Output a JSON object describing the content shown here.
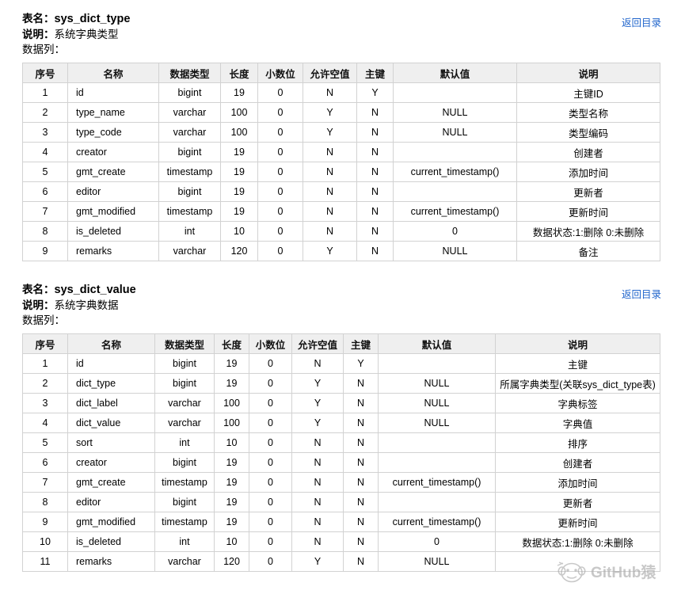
{
  "document": {
    "watermark_text": "GitHub猿",
    "link_color": "#2266cc",
    "header_bg": "#efefef",
    "border_color": "#d2d2d2"
  },
  "labels": {
    "table_name_label": "表名：",
    "description_label": "说明：",
    "columns_label": "数据列：",
    "back_to_index": "返回目录"
  },
  "columns": [
    "序号",
    "名称",
    "数据类型",
    "长度",
    "小数位",
    "允许空值",
    "主键",
    "默认值",
    "说明"
  ],
  "tables": [
    {
      "name": "sys_dict_type",
      "description": "系统字典类型",
      "rows": [
        [
          "1",
          "id",
          "bigint",
          "19",
          "0",
          "N",
          "Y",
          "",
          "主键ID"
        ],
        [
          "2",
          "type_name",
          "varchar",
          "100",
          "0",
          "Y",
          "N",
          "NULL",
          "类型名称"
        ],
        [
          "3",
          "type_code",
          "varchar",
          "100",
          "0",
          "Y",
          "N",
          "NULL",
          "类型编码"
        ],
        [
          "4",
          "creator",
          "bigint",
          "19",
          "0",
          "N",
          "N",
          "",
          "创建者"
        ],
        [
          "5",
          "gmt_create",
          "timestamp",
          "19",
          "0",
          "N",
          "N",
          "current_timestamp()",
          "添加时间"
        ],
        [
          "6",
          "editor",
          "bigint",
          "19",
          "0",
          "N",
          "N",
          "",
          "更新者"
        ],
        [
          "7",
          "gmt_modified",
          "timestamp",
          "19",
          "0",
          "N",
          "N",
          "current_timestamp()",
          "更新时间"
        ],
        [
          "8",
          "is_deleted",
          "int",
          "10",
          "0",
          "N",
          "N",
          "0",
          "数据状态:1:删除 0:未删除"
        ],
        [
          "9",
          "remarks",
          "varchar",
          "120",
          "0",
          "Y",
          "N",
          "NULL",
          "备注"
        ]
      ]
    },
    {
      "name": "sys_dict_value",
      "description": "系统字典数据",
      "rows": [
        [
          "1",
          "id",
          "bigint",
          "19",
          "0",
          "N",
          "Y",
          "",
          "主键"
        ],
        [
          "2",
          "dict_type",
          "bigint",
          "19",
          "0",
          "Y",
          "N",
          "NULL",
          "所属字典类型(关联sys_dict_type表)"
        ],
        [
          "3",
          "dict_label",
          "varchar",
          "100",
          "0",
          "Y",
          "N",
          "NULL",
          "字典标签"
        ],
        [
          "4",
          "dict_value",
          "varchar",
          "100",
          "0",
          "Y",
          "N",
          "NULL",
          "字典值"
        ],
        [
          "5",
          "sort",
          "int",
          "10",
          "0",
          "N",
          "N",
          "",
          "排序"
        ],
        [
          "6",
          "creator",
          "bigint",
          "19",
          "0",
          "N",
          "N",
          "",
          "创建者"
        ],
        [
          "7",
          "gmt_create",
          "timestamp",
          "19",
          "0",
          "N",
          "N",
          "current_timestamp()",
          "添加时间"
        ],
        [
          "8",
          "editor",
          "bigint",
          "19",
          "0",
          "N",
          "N",
          "",
          "更新者"
        ],
        [
          "9",
          "gmt_modified",
          "timestamp",
          "19",
          "0",
          "N",
          "N",
          "current_timestamp()",
          "更新时间"
        ],
        [
          "10",
          "is_deleted",
          "int",
          "10",
          "0",
          "N",
          "N",
          "0",
          "数据状态:1:删除 0:未删除"
        ],
        [
          "11",
          "remarks",
          "varchar",
          "120",
          "0",
          "Y",
          "N",
          "NULL",
          ""
        ]
      ]
    }
  ]
}
